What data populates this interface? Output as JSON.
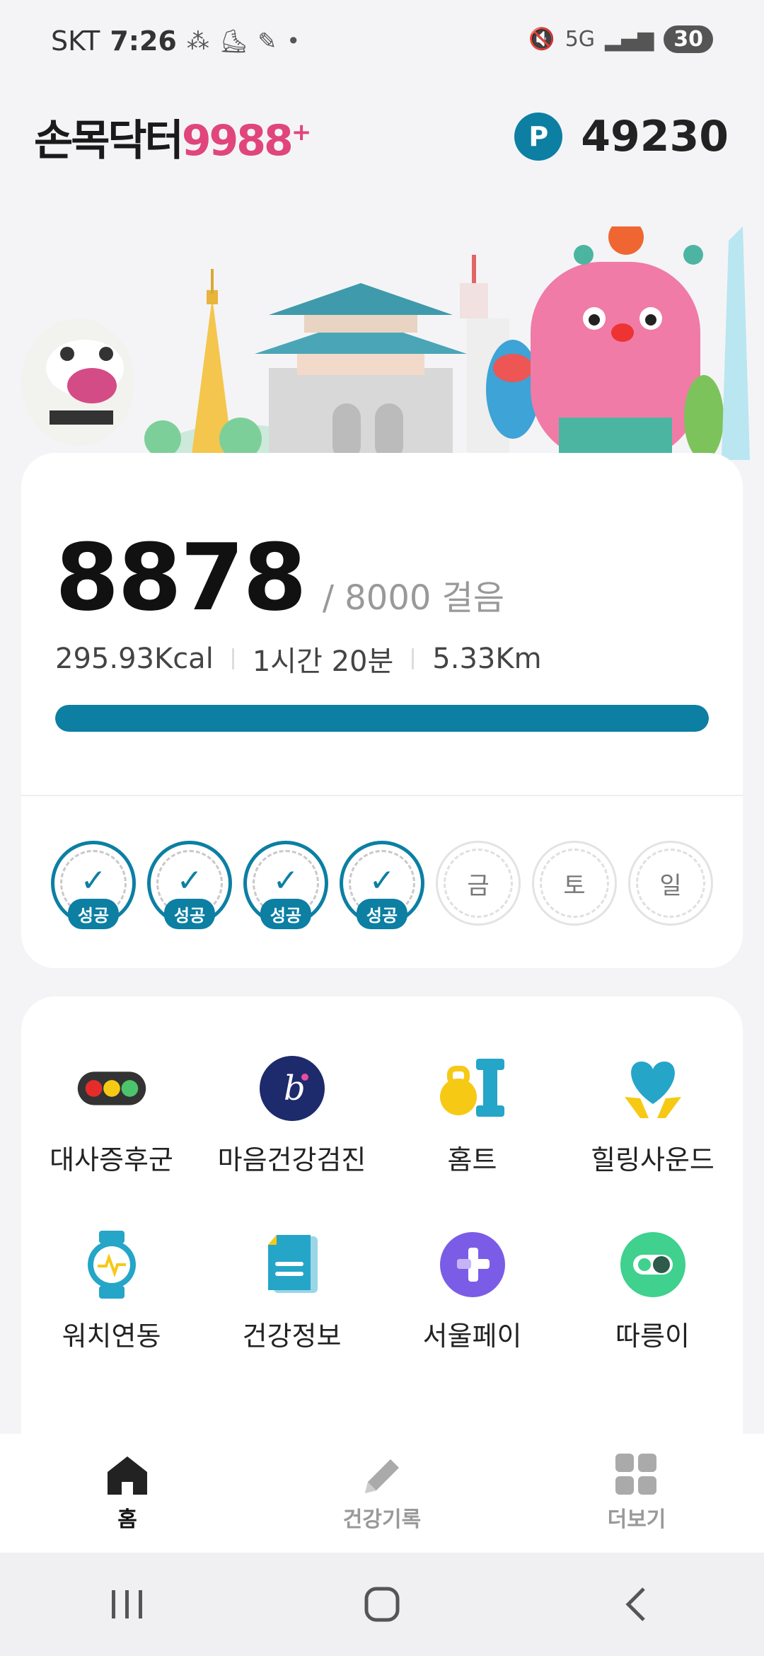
{
  "status_bar": {
    "carrier": "SKT",
    "time": "7:26",
    "network": "5G",
    "battery": "30"
  },
  "header": {
    "logo_korean": "손목닥터",
    "logo_number": "9988",
    "logo_plus": "+",
    "points_badge": "P",
    "points_value": "49230"
  },
  "steps": {
    "current": "8878",
    "goal_text": "/ 8000 걸음",
    "calories": "295.93Kcal",
    "duration": "1시간 20분",
    "distance": "5.33Km",
    "progress_fraction": 1.0
  },
  "week": [
    {
      "state": "done",
      "label": "성공"
    },
    {
      "state": "done",
      "label": "성공"
    },
    {
      "state": "done",
      "label": "성공"
    },
    {
      "state": "done",
      "label": "성공"
    },
    {
      "state": "todo",
      "label": "금"
    },
    {
      "state": "todo",
      "label": "토"
    },
    {
      "state": "todo",
      "label": "일"
    }
  ],
  "menu": [
    {
      "label": "대사증후군",
      "icon": "traffic-light-icon"
    },
    {
      "label": "마음건강검진",
      "icon": "mind-health-icon"
    },
    {
      "label": "홈트",
      "icon": "kettlebell-icon"
    },
    {
      "label": "힐링사운드",
      "icon": "heart-hands-icon"
    },
    {
      "label": "워치연동",
      "icon": "smartwatch-icon"
    },
    {
      "label": "건강정보",
      "icon": "document-icon"
    },
    {
      "label": "서울페이",
      "icon": "seoulpay-icon"
    },
    {
      "label": "따릉이",
      "icon": "bike-share-icon"
    }
  ],
  "bottom_nav": {
    "home": "홈",
    "record": "건강기록",
    "more": "더보기"
  },
  "colors": {
    "accent": "#0c7fa3",
    "pink": "#e0457b"
  }
}
